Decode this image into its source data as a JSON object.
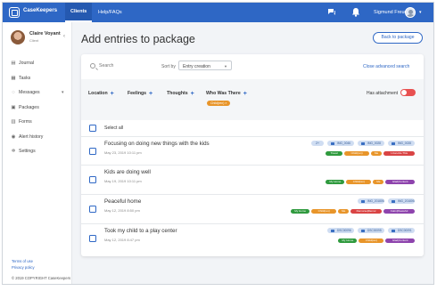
{
  "app": {
    "brand": "CaseKeepers"
  },
  "topnav": {
    "items": [
      "Clients",
      "Help/FAQs"
    ],
    "user_name": "Sigmund Freud",
    "caret": "▾"
  },
  "sidebar": {
    "client_name": "Claire Voyant",
    "client_role": "Client",
    "chevron": "‹",
    "items": [
      {
        "label": "Journal",
        "icon": "journal-icon",
        "glyph": "▤"
      },
      {
        "label": "Tasks",
        "icon": "tasks-icon",
        "glyph": "▦"
      },
      {
        "label": "Messages",
        "icon": "messages-icon",
        "glyph": "◌",
        "arrow": "▾"
      },
      {
        "label": "Packages",
        "icon": "packages-icon",
        "glyph": "▣"
      },
      {
        "label": "Forms",
        "icon": "forms-icon",
        "glyph": "▥"
      },
      {
        "label": "Alert history",
        "icon": "alert-icon",
        "glyph": "◉"
      },
      {
        "label": "Settings",
        "icon": "settings-icon",
        "glyph": "✲"
      }
    ],
    "footer": {
      "terms": "Terms of use",
      "privacy": "Privacy policy",
      "copyright": "© 2019 COPYRIGHT CaseKeepers"
    }
  },
  "page": {
    "title": "Add entries to package",
    "back_button": "Back to package"
  },
  "toolbar": {
    "search_placeholder": "Search",
    "sort_label": "Sort by",
    "sort_value": "Entry creation",
    "close_advanced": "Close advanced search"
  },
  "filters": {
    "labels": [
      "Location",
      "Feelings",
      "Thoughts",
      "Who Was There"
    ],
    "plus": "+",
    "who_tag": "Child(ren)",
    "has_attachment_label": "Has attachment",
    "has_attachment_on": false
  },
  "list": {
    "select_all": "Select all",
    "entries": [
      {
        "title": "Focusing on doing new things with the kids",
        "date": "May 23, 2019 10:11 pm",
        "more_count": "2+",
        "attachments": [
          "IMG_0046",
          "IMG_0028",
          "IMG_0028"
        ],
        "tags": [
          {
            "label": "Travel",
            "color": "#2f9a3e"
          },
          {
            "label": "Child(ren)",
            "color": "#e8952a"
          },
          {
            "label": "Me",
            "color": "#e8952a"
          },
          {
            "label": "I-Can-Do-This",
            "color": "#d94444"
          }
        ]
      },
      {
        "title": "Kids are doing well",
        "date": "May 19, 2019 10:11 pm",
        "more_count": "",
        "attachments": [],
        "tags": [
          {
            "label": "My Home",
            "color": "#2f9a3e"
          },
          {
            "label": "Child(ren)",
            "color": "#e8952a"
          },
          {
            "label": "Me",
            "color": "#e8952a"
          },
          {
            "label": "Glad|Content",
            "color": "#8e44ad"
          }
        ]
      },
      {
        "title": "Peaceful home",
        "date": "May 12, 2019 8:50 pm",
        "more_count": "",
        "attachments": [
          "IMG_20180927_1...",
          "IMG_20180927_1..."
        ],
        "tags": [
          {
            "label": "My Home",
            "color": "#2f9a3e"
          },
          {
            "label": "Child(ren)",
            "color": "#e8952a"
          },
          {
            "label": "Me",
            "color": "#e8952a"
          },
          {
            "label": "Remorse|Remor",
            "color": "#d94444"
          },
          {
            "label": "Calm|Peaceful",
            "color": "#8e44ad"
          }
        ]
      },
      {
        "title": "Took my child to a play center",
        "date": "May 12, 2019 8:47 pm",
        "more_count": "",
        "attachments": [
          "DSC00096",
          "DSC00095",
          "DSC00091"
        ],
        "tags": [
          {
            "label": "My Home",
            "color": "#2f9a3e"
          },
          {
            "label": "Child(ren)",
            "color": "#e8952a"
          },
          {
            "label": "Glad|Content",
            "color": "#8e44ad"
          }
        ]
      }
    ]
  },
  "colors": {
    "brand_blue": "#2e67c5",
    "toggle_off": "#e85151"
  }
}
